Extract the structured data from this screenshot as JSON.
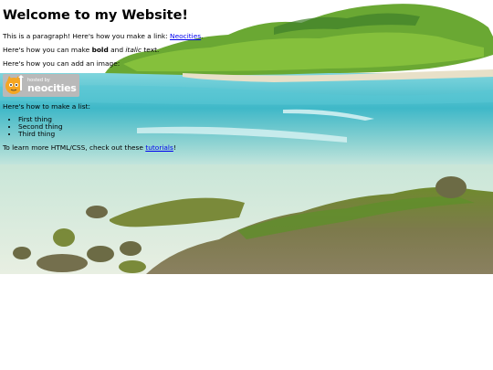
{
  "heading": "Welcome to my Website!",
  "para1": {
    "text": "This is a paragraph! Here's how you make a link: ",
    "link": "Neocities",
    "end": "."
  },
  "para2": {
    "pre": "Here's how you can make ",
    "bold": "bold",
    "mid": " and ",
    "italic": "italic",
    "end": " text."
  },
  "para3": "Here's how you can add an image:",
  "badge": {
    "small": "hosted by",
    "big": "neocities",
    "icon": "neocities-cat-icon"
  },
  "list_intro": "Here's how to make a list:",
  "list_items": [
    "First thing",
    "Second thing",
    "Third thing"
  ],
  "footer": {
    "pre": "To learn more HTML/CSS, check out these ",
    "link": "tutorials",
    "end": "!"
  },
  "colors": {
    "link": "#0000ee",
    "sea": "#5ec4d0",
    "island": "#6aa833",
    "badge_bg": "#b9b9b9"
  }
}
